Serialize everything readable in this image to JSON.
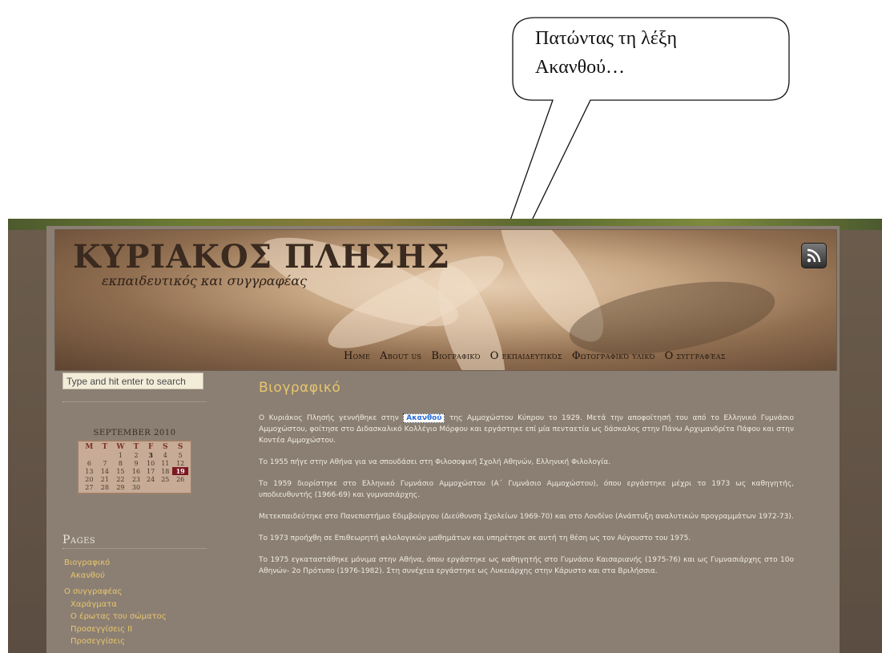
{
  "callout": {
    "line1": "Πατώντας τη λέξη",
    "line2": "Ακανθού…"
  },
  "site": {
    "title": "ΚΥΡΙΑΚΟΣ ΠΛΗΣΗΣ",
    "subtitle": "εκπαιδευτικός και συγγραφέας",
    "rss_icon": "rss-icon"
  },
  "nav": [
    "Home",
    "About us",
    "Βιογραφικό",
    "Ο εκπαιδευτικός",
    "Φωτογραφικό υλικό",
    "Ο συγγραφέας"
  ],
  "search": {
    "placeholder": "Type and hit enter to search"
  },
  "calendar": {
    "caption": "SEPTEMBER 2010",
    "days": [
      "M",
      "T",
      "W",
      "T",
      "F",
      "S",
      "S"
    ],
    "weeks": [
      [
        "",
        "",
        "1",
        "2",
        "3",
        "4",
        "5"
      ],
      [
        "6",
        "7",
        "8",
        "9",
        "10",
        "11",
        "12"
      ],
      [
        "13",
        "14",
        "15",
        "16",
        "17",
        "18",
        "19"
      ],
      [
        "20",
        "21",
        "22",
        "23",
        "24",
        "25",
        "26"
      ],
      [
        "27",
        "28",
        "29",
        "30",
        "",
        "",
        ""
      ]
    ],
    "today": "19",
    "bold_day": "3"
  },
  "pages": {
    "title": "Pages",
    "items": [
      {
        "label": "Βιογραφικό",
        "level": 1
      },
      {
        "label": "Ακανθού",
        "level": 2
      },
      {
        "label": "Ο συγγραφέας",
        "level": 1
      },
      {
        "label": "Χαράγματα",
        "level": 2
      },
      {
        "label": "Ο έρωτας του σώματος",
        "level": 2
      },
      {
        "label": "Προσεγγίσεις ΙΙ",
        "level": 2
      },
      {
        "label": "Προσεγγίσεις",
        "level": 2
      }
    ]
  },
  "post": {
    "title": "Βιογραφικό",
    "p1_before": "Ο Κυριάκος Πλησής γεννήθηκε στην",
    "p1_link": "Ακανθού",
    "p1_after": "της Αμμοχώστου Κύπρου το 1929. Μετά την αποφοίτησή του από το Ελληνικό Γυμνάσιο Αμμοχώστου, φοίτησε στο Διδασκαλικό Κολλέγιο Μόρφου και εργάστηκε επί μία πενταετία ως δάσκαλος στην Πάνω Αρχιμανδρίτα Πάφου και στην Κοντέα Αμμοχώστου.",
    "p2": "Το 1955 πήγε στην Αθήνα για να σπουδάσει στη Φιλοσοφική Σχολή Αθηνών, Ελληνική Φιλολογία.",
    "p3": "Το 1959 διορίστηκε στο Ελληνικό Γυμνάσιο Αμμοχώστου (Α΄ Γυμνάσιο Αμμοχώστου), όπου εργάστηκε μέχρι το 1973 ως καθηγητής, υποδιευθυντής (1966-69) και γυμνασιάρχης.",
    "p4": "Μετεκπαιδεύτηκε στο Πανεπιστήμιο Εδιμβούργου (Διεύθυνση Σχολείων 1969-70) και στο Λονδίνο (Ανάπτυξη αναλυτικών προγραμμάτων 1972-73).",
    "p5": "Το 1973 προήχθη σε Επιθεωρητή φιλολογικών μαθημάτων και υπηρέτησε σε αυτή τη θέση ως τον Αύγουστο του 1975.",
    "p6": "Το 1975 εγκαταστάθηκε μόνιμα στην Αθήνα, όπου εργάστηκε ως καθηγητής στο Γυμνάσιο Καισαριανής (1975-76) και ως Γυμνασιάρχης στο 10ο Αθηνών- 2ο Πρότυπο (1976-1982). Στη συνέχεια εργάστηκε ως Λυκειάρχης στην Κάρυστο και στα Βριλήσσια."
  }
}
